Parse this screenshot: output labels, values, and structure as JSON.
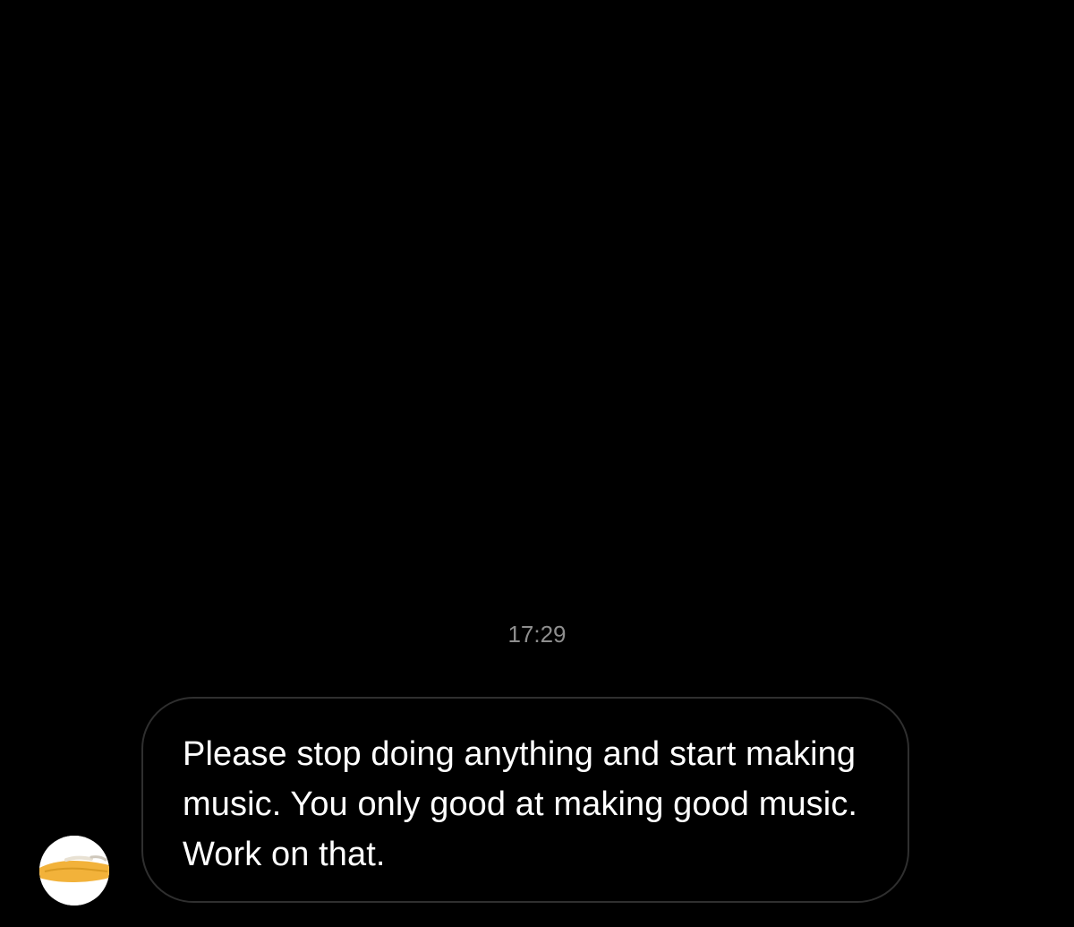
{
  "conversation": {
    "timestamp": "17:29",
    "messages": [
      {
        "sender_avatar_icon": "avatar-photo",
        "text": "Please stop doing anything and start making music. You only good at making good music. Work on that."
      }
    ]
  },
  "colors": {
    "background": "#000000",
    "bubble_border": "#2f2f2f",
    "message_text": "#ffffff",
    "timestamp_text": "#8e8e8e",
    "avatar_accent": "#f2b23a"
  }
}
